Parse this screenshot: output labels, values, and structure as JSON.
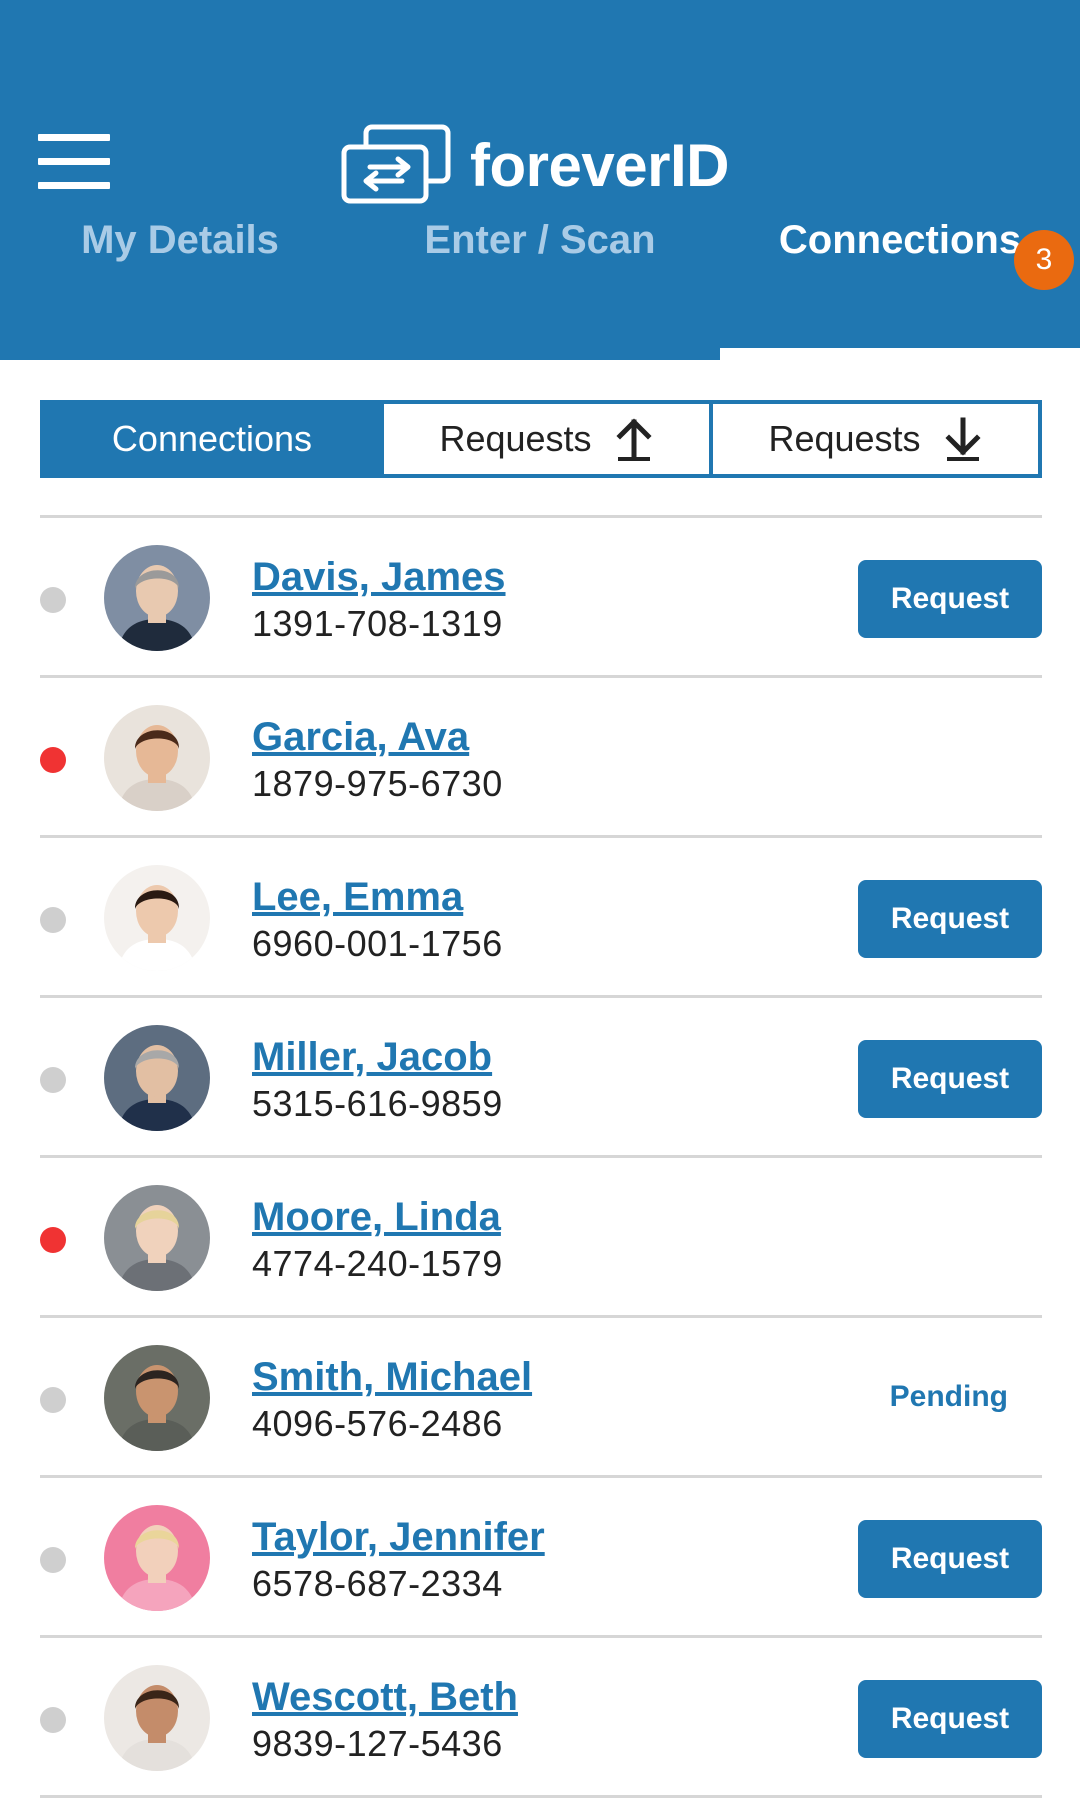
{
  "app": {
    "brand": "foreverID",
    "menu_icon": "hamburger-menu-icon",
    "logo_icon": "transfer-arrows-icon",
    "colors": {
      "primary": "#2077b1",
      "badge": "#ea6a10",
      "status_active": "#f03333",
      "status_inactive": "#cfcfcf"
    }
  },
  "tabs": [
    {
      "label": "My Details",
      "active": false
    },
    {
      "label": "Enter / Scan",
      "active": false
    },
    {
      "label": "Connections",
      "active": true,
      "badge": "3"
    }
  ],
  "segments": [
    {
      "label": "Connections",
      "active": true
    },
    {
      "label": "Requests",
      "icon": "upload-arrow-icon",
      "active": false
    },
    {
      "label": "Requests",
      "icon": "download-arrow-icon",
      "active": false
    }
  ],
  "contacts": [
    {
      "name": "Davis, James",
      "phone": "1391-708-1319",
      "status": "inactive",
      "action": "Request"
    },
    {
      "name": "Garcia, Ava",
      "phone": "1879-975-6730",
      "status": "active",
      "action": ""
    },
    {
      "name": "Lee, Emma",
      "phone": "6960-001-1756",
      "status": "inactive",
      "action": "Request"
    },
    {
      "name": "Miller, Jacob",
      "phone": "5315-616-9859",
      "status": "inactive",
      "action": "Request"
    },
    {
      "name": "Moore, Linda",
      "phone": "4774-240-1579",
      "status": "active",
      "action": ""
    },
    {
      "name": "Smith, Michael",
      "phone": "4096-576-2486",
      "status": "inactive",
      "action": "Pending"
    },
    {
      "name": "Taylor, Jennifer",
      "phone": "6578-687-2334",
      "status": "inactive",
      "action": "Request"
    },
    {
      "name": "Wescott, Beth",
      "phone": "9839-127-5436",
      "status": "inactive",
      "action": "Request"
    }
  ]
}
